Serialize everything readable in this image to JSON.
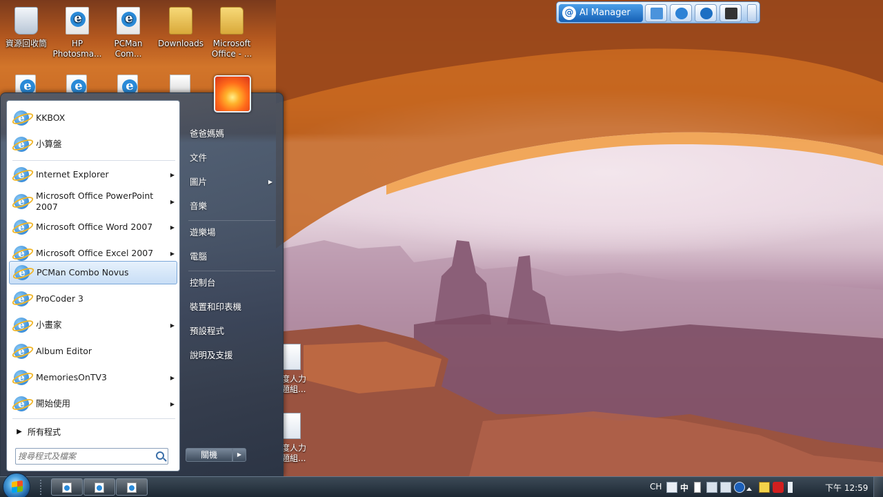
{
  "desktop": {
    "icons": [
      {
        "label": "資源回收筒",
        "type": "recycle-bin"
      },
      {
        "label": "HP Photosma...",
        "type": "document"
      },
      {
        "label": "PCMan Com...",
        "type": "document"
      },
      {
        "label": "Downloads",
        "type": "folder"
      },
      {
        "label": "Microsoft Office - ...",
        "type": "folder"
      }
    ],
    "partial_icons": [
      {
        "label": "度人力 題組..."
      },
      {
        "label": "度人力 題組..."
      }
    ]
  },
  "ai_manager": {
    "logo_label": "AI Manager",
    "buttons": [
      "window-icon",
      "face-icon",
      "asus-icon",
      "monitor-icon"
    ]
  },
  "start_menu": {
    "programs": [
      {
        "label": "KKBOX",
        "has_submenu": false
      },
      {
        "label": "小算盤",
        "has_submenu": false
      },
      {
        "label": "Internet Explorer",
        "has_submenu": true
      },
      {
        "label": "Microsoft Office PowerPoint 2007",
        "has_submenu": true
      },
      {
        "label": "Microsoft Office Word 2007",
        "has_submenu": true
      },
      {
        "label": "Microsoft Office Excel 2007",
        "has_submenu": true
      },
      {
        "label": "PCMan Combo Novus",
        "has_submenu": false,
        "selected": true
      },
      {
        "label": "ProCoder 3",
        "has_submenu": false
      },
      {
        "label": "小畫家",
        "has_submenu": true
      },
      {
        "label": "Album Editor",
        "has_submenu": false
      },
      {
        "label": "MemoriesOnTV3",
        "has_submenu": true
      },
      {
        "label": "開始使用",
        "has_submenu": true
      }
    ],
    "all_programs_label": "所有程式",
    "search_placeholder": "搜尋程式及檔案",
    "right_items": [
      {
        "label": "爸爸媽媽"
      },
      {
        "label": "文件"
      },
      {
        "label": "圖片"
      },
      {
        "label": "音樂"
      },
      {
        "label": "遊樂場"
      },
      {
        "label": "電腦"
      },
      {
        "label": "控制台"
      },
      {
        "label": "裝置和印表機"
      },
      {
        "label": "預設程式"
      },
      {
        "label": "說明及支援"
      }
    ],
    "shutdown_label": "關機",
    "arrow_glyph": "▶"
  },
  "taskbar": {
    "tray": {
      "language": "CH",
      "ime_mode": "中",
      "clock": "下午 12:59"
    }
  }
}
